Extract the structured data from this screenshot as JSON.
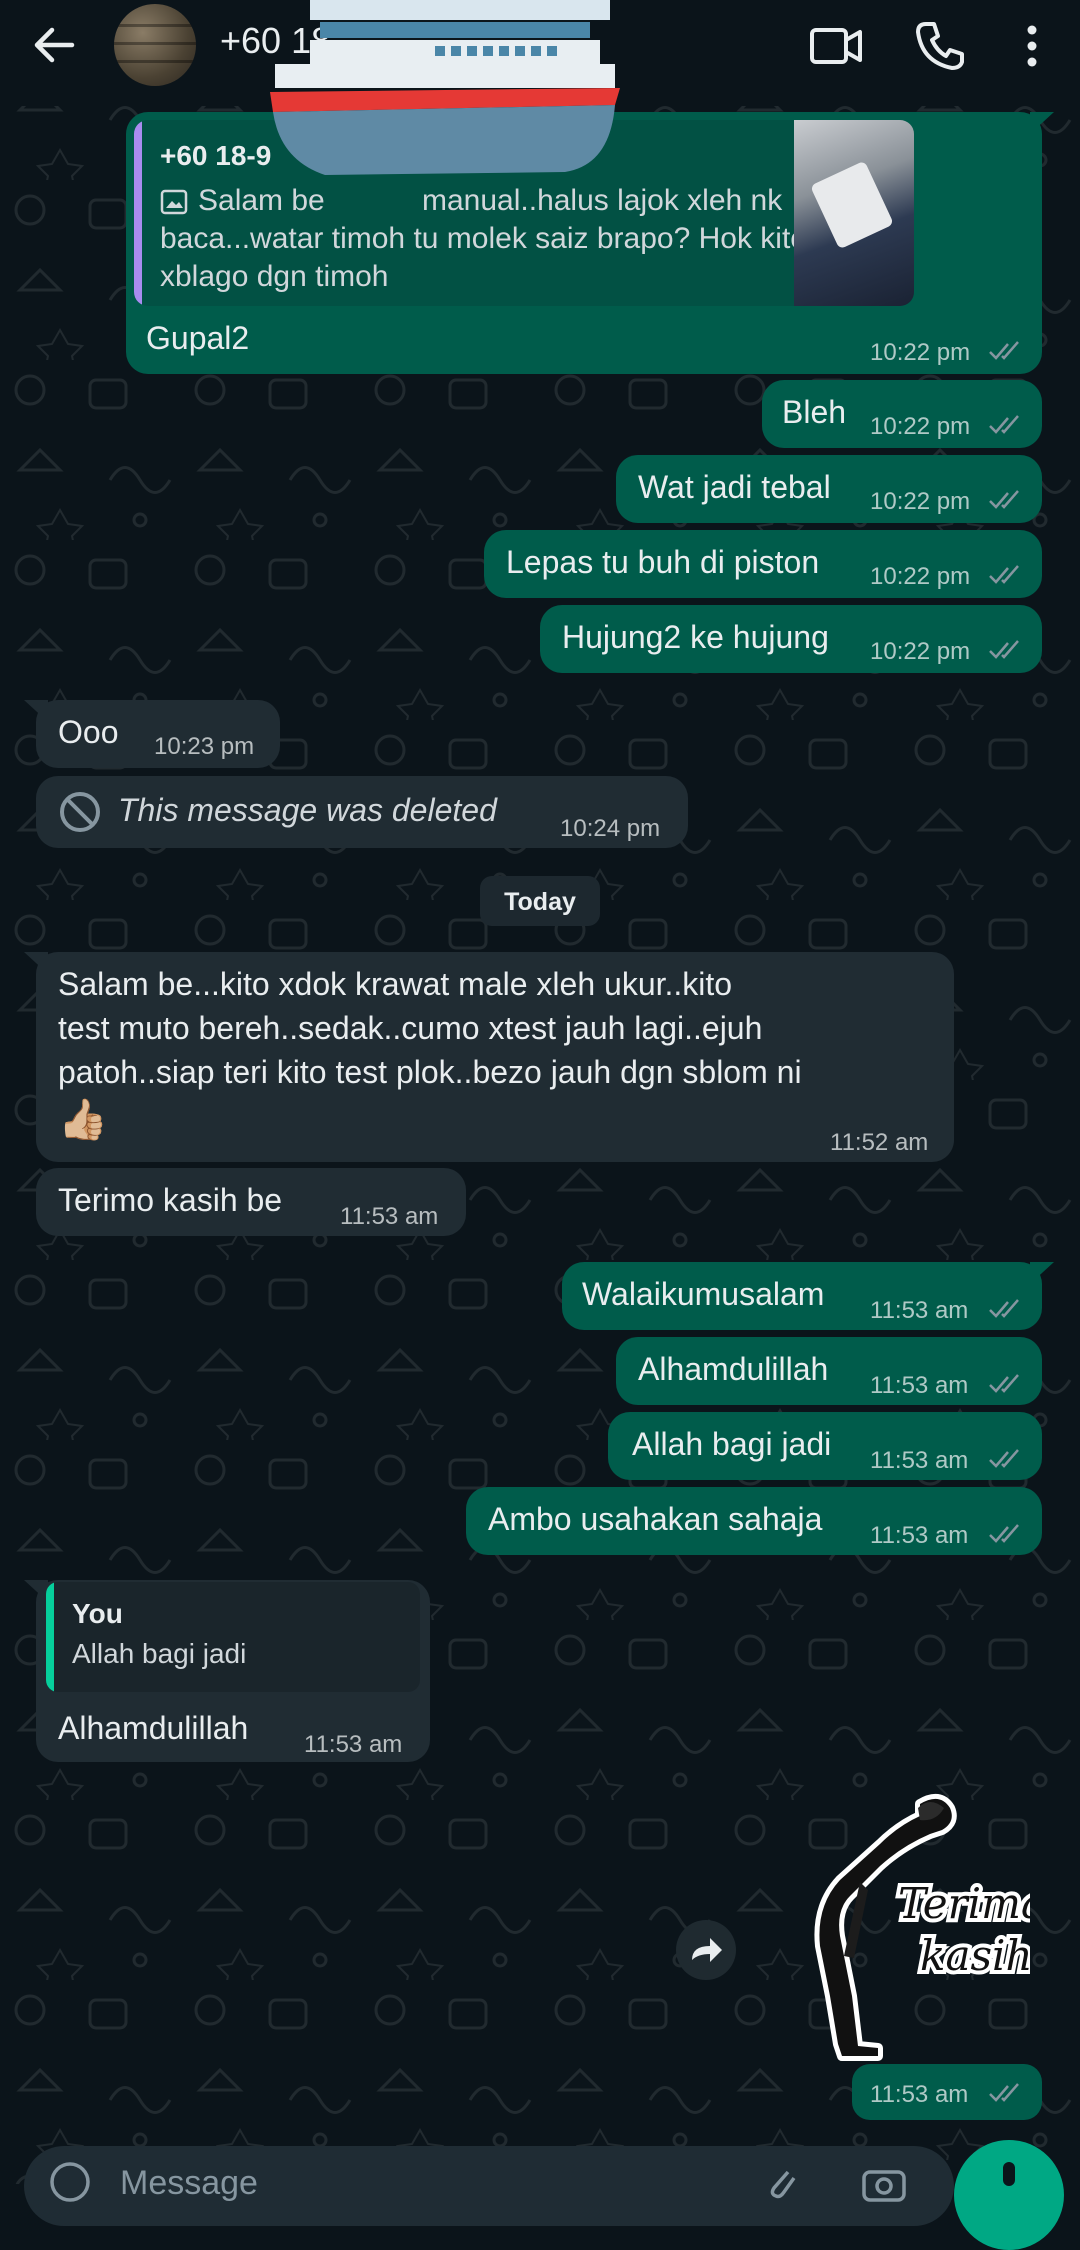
{
  "header": {
    "contact_name": "+60 18",
    "icons": [
      "back-arrow-icon",
      "video-call-icon",
      "voice-call-icon",
      "more-vert-icon"
    ]
  },
  "messages": {
    "m1": {
      "quote_name": "+60 18-9",
      "quote_line1": "Salam be",
      "quote_line1b": "manual..halus lajok xleh nk",
      "quote_line2": "baca...watar timoh tu molek saiz brapo? Hok kito ni",
      "quote_line3": "xblago dgn timoh",
      "text": "Gupal2",
      "time": "10:22 pm"
    },
    "m2": {
      "text": "Bleh",
      "time": "10:22 pm"
    },
    "m3": {
      "text": "Wat jadi tebal",
      "time": "10:22 pm"
    },
    "m4": {
      "text": "Lepas tu buh di piston",
      "time": "10:22 pm"
    },
    "m5": {
      "text": "Hujung2 ke hujung",
      "time": "10:22 pm"
    },
    "m6": {
      "text": "Ooo",
      "time": "10:23 pm"
    },
    "m7": {
      "text": "This message was deleted",
      "time": "10:24 pm"
    },
    "day_separator": "Today",
    "m8": {
      "line1": "Salam be...kito xdok krawat male xleh ukur..kito",
      "line2": "test muto bereh..sedak..cumo xtest  jauh lagi..ejuh",
      "line3": "patoh..siap teri kito test plok..bezo jauh dgn sblom ni",
      "emoji": "👍🏼",
      "time": "11:52 am"
    },
    "m9": {
      "text": "Terimo kasih be",
      "time": "11:53 am"
    },
    "m10": {
      "text": "Walaikumusalam",
      "time": "11:53 am"
    },
    "m11": {
      "text": "Alhamdulillah",
      "time": "11:53 am"
    },
    "m12": {
      "text": "Allah bagi jadi",
      "time": "11:53 am"
    },
    "m13": {
      "text": "Ambo usahakan sahaja",
      "time": "11:53 am"
    },
    "m14": {
      "quote_name": "You",
      "quote_text": "Allah bagi jadi",
      "text": "Alhamdulillah",
      "time": "11:53 am"
    },
    "sticker": {
      "line1": "Terima",
      "line2": "kasih",
      "time": "11:53 am"
    }
  },
  "input": {
    "placeholder": "Message"
  },
  "colors": {
    "background": "#0b141a",
    "outgoing_bubble": "#005c4b",
    "incoming_bubble": "#202c33",
    "read_ticks": "#8696a0",
    "accent": "#00a884"
  }
}
